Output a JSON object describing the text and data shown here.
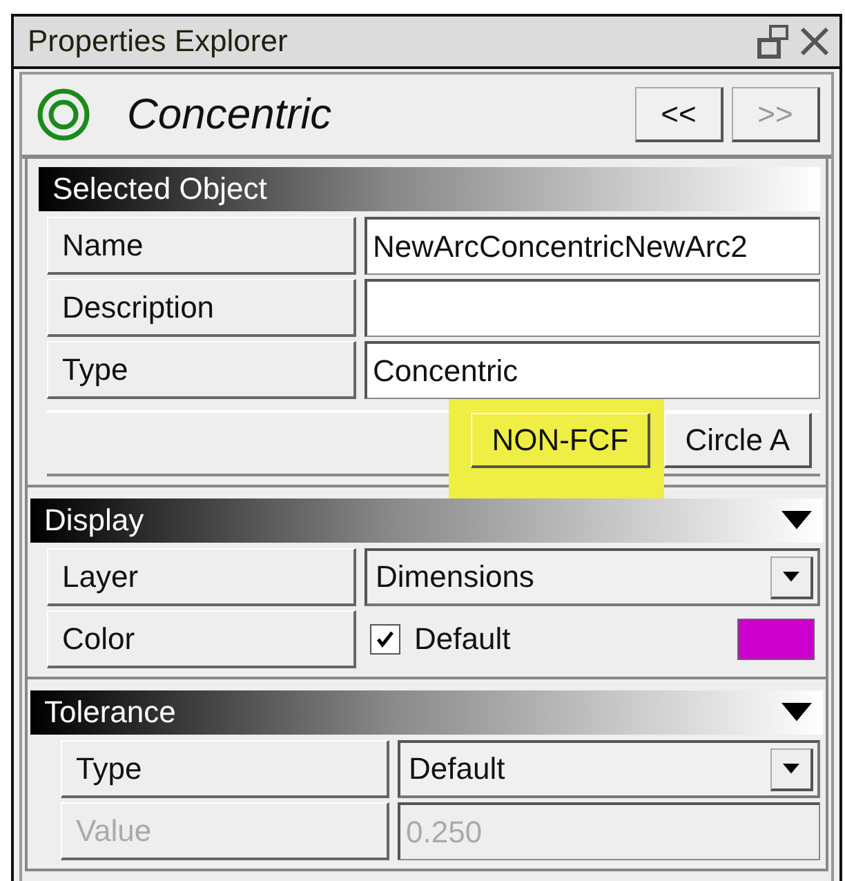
{
  "window": {
    "title": "Properties Explorer"
  },
  "header": {
    "title": "Concentric",
    "nav": [
      {
        "label": "<<",
        "disabled": false
      },
      {
        "label": ">>",
        "disabled": true
      }
    ]
  },
  "sections": [
    {
      "title": "Selected Object",
      "collapsible": false,
      "rows": [
        {
          "label": "Name",
          "kind": "text",
          "value": "NewArcConcentricNewArc2",
          "disabled": false
        },
        {
          "label": "Description",
          "kind": "text",
          "value": "",
          "disabled": false
        },
        {
          "label": "Type",
          "kind": "text",
          "value": "Concentric",
          "disabled": false
        }
      ],
      "buttons": [
        {
          "label": "NON-FCF",
          "highlighted": true
        },
        {
          "label": "Circle A",
          "highlighted": false
        }
      ]
    },
    {
      "title": "Display",
      "collapsible": true,
      "rows": [
        {
          "label": "Layer",
          "kind": "dropdown",
          "value": "Dimensions",
          "disabled": false
        },
        {
          "label": "Color",
          "kind": "color",
          "value": "Default",
          "checked": true,
          "color": "#cc00cc",
          "disabled": false
        }
      ]
    },
    {
      "title": "Tolerance",
      "collapsible": true,
      "indent": true,
      "rows": [
        {
          "label": "Type",
          "kind": "dropdown",
          "value": "Default",
          "disabled": false
        },
        {
          "label": "Value",
          "kind": "text",
          "value": "0.250",
          "disabled": true
        }
      ]
    }
  ]
}
